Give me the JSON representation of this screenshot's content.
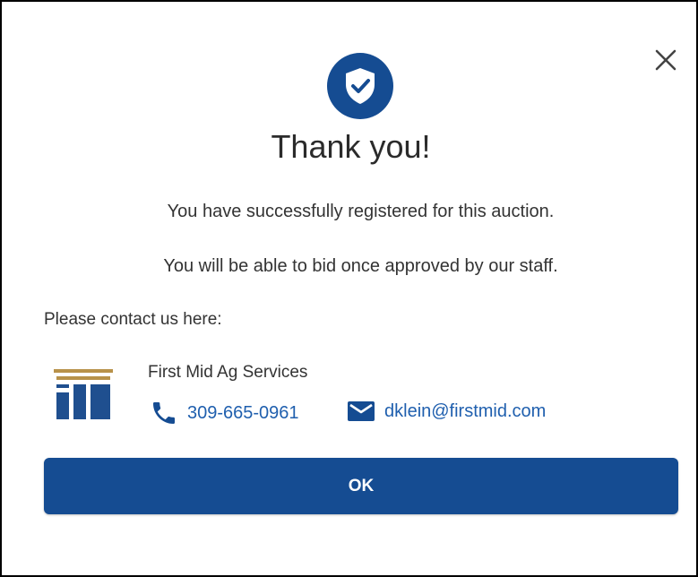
{
  "dialog": {
    "title": "Thank you!",
    "messages": [
      "You have successfully registered for this auction.",
      "You will be able to bid once approved by our staff."
    ],
    "contact_label": "Please contact us here:",
    "contact": {
      "organization": "First Mid Ag Services",
      "phone": "309-665-0961",
      "email": "dklein@firstmid.com"
    },
    "ok_label": "OK",
    "icons": {
      "close": "close-icon",
      "badge": "shield-check-icon",
      "phone": "phone-icon",
      "email": "mail-icon",
      "logo": "first-mid-logo"
    }
  },
  "colors": {
    "primary": "#154c92",
    "link": "#1f5fae",
    "logo_gold": "#b8924a",
    "text": "#333333"
  }
}
